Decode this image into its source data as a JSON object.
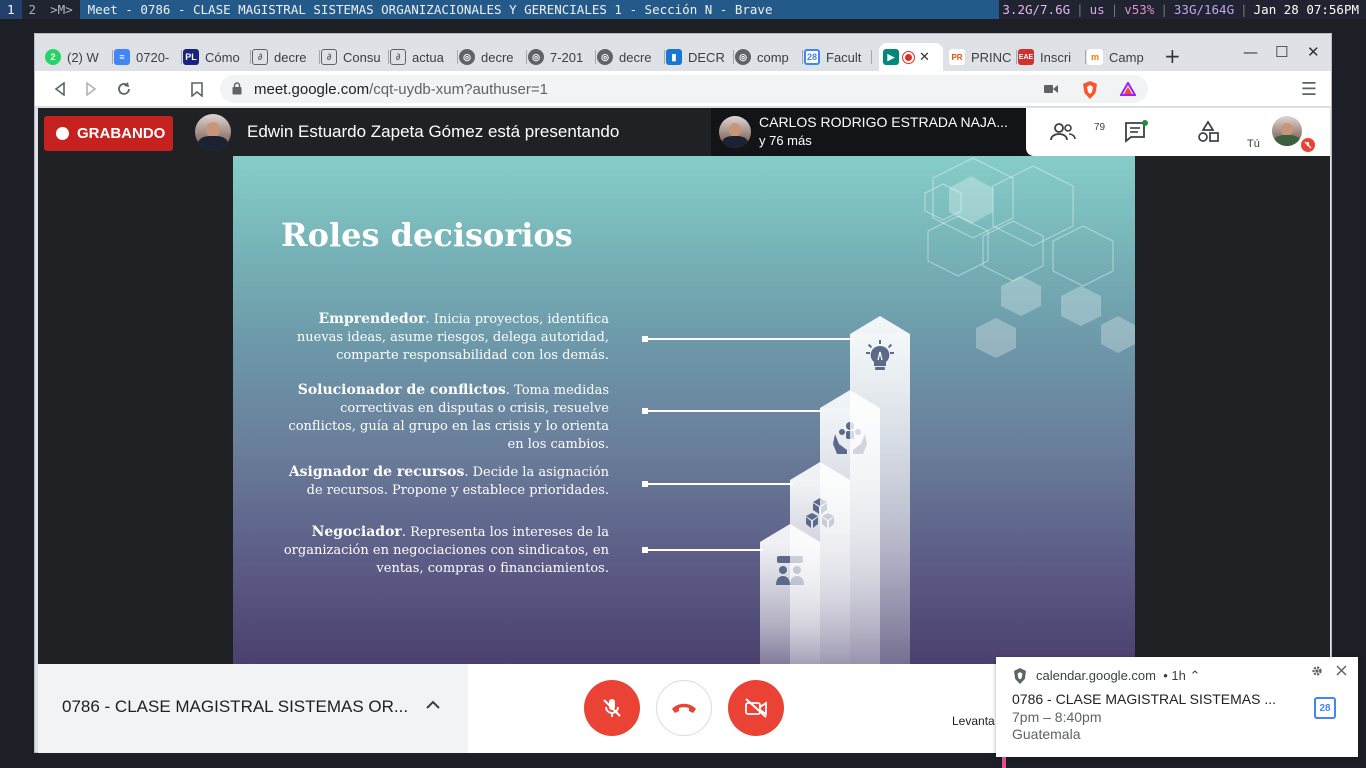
{
  "wm": {
    "workspaces": [
      "1",
      "2"
    ],
    "mode": ">M>",
    "title": "Meet - 0786 - CLASE MAGISTRAL SISTEMAS ORGANIZACIONALES Y GERENCIALES 1 - Sección N - Brave",
    "mem": "3.2G/7.6G",
    "lang": "us",
    "vol": "v53%",
    "disk": "33G/164G",
    "clock": "Jan 28 07:56PM"
  },
  "tabs": [
    {
      "label": "(2) W",
      "icon": "whatsapp-icon",
      "color": "#25d366"
    },
    {
      "label": "0720-",
      "icon": "google-docs-icon",
      "color": "#4285f4"
    },
    {
      "label": "Cómo",
      "icon": "pl-icon",
      "color": "#1a237e"
    },
    {
      "label": "decre",
      "icon": "link-icon",
      "color": "#5f6368"
    },
    {
      "label": "Consu",
      "icon": "link-icon",
      "color": "#5f6368"
    },
    {
      "label": "actua",
      "icon": "link-icon",
      "color": "#5f6368"
    },
    {
      "label": "decre",
      "icon": "globe-icon",
      "color": "#5f6368"
    },
    {
      "label": "7-201",
      "icon": "globe-icon",
      "color": "#5f6368"
    },
    {
      "label": "decre",
      "icon": "globe-icon",
      "color": "#5f6368"
    },
    {
      "label": "DECR",
      "icon": "doc-icon",
      "color": "#1976d2"
    },
    {
      "label": "comp",
      "icon": "globe-icon",
      "color": "#5f6368"
    },
    {
      "label": "Facult",
      "icon": "calendar-icon",
      "color": "#4285f4"
    },
    {
      "label": "",
      "icon": "meet-icon",
      "color": "#00897b"
    },
    {
      "label": "PRINC",
      "icon": "prin-icon",
      "color": "#e65100"
    },
    {
      "label": "Inscri",
      "icon": "eae-icon",
      "color": "#d32f2f"
    },
    {
      "label": "Camp",
      "icon": "moodle-icon",
      "color": "#f57c00"
    }
  ],
  "url": {
    "host": "meet.google.com",
    "path": "/cqt-uydb-xum?authuser=1"
  },
  "meet": {
    "recording_label": "GRABANDO",
    "presenter_text": "Edwin Estuardo Zapeta Gómez está presentando",
    "speaker_name": "CARLOS RODRIGO ESTRADA NAJA...",
    "speaker_more": "y 76 más",
    "people_count": "79",
    "self_label": "Tú",
    "meeting_name": "0786 - CLASE MAGISTRAL SISTEMAS OR...",
    "raise_hand_label": "Levanta"
  },
  "slide": {
    "title": "Roles decisorios",
    "roles": [
      {
        "name": "Emprendedor",
        "desc": ". Inicia proyectos, identifica nuevas ideas, asume riesgos, delega autoridad, comparte responsabilidad con los demás."
      },
      {
        "name": "Solucionador de conflictos",
        "desc": ". Toma medidas correctivas en disputas o crisis, resuelve conflictos, guía al grupo en las crisis y lo orienta en los cambios."
      },
      {
        "name": "Asignador de recursos",
        "desc": ". Decide la asignación de recursos. Propone y establece prioridades."
      },
      {
        "name": "Negociador",
        "desc": ". Representa los intereses de la organización en negociaciones con sindicatos, en ventas, compras o financiamientos."
      }
    ]
  },
  "notification": {
    "origin": "calendar.google.com",
    "age": "• 1h ⌃",
    "title": "0786 - CLASE MAGISTRAL SISTEMAS ...",
    "time": "7pm – 8:40pm",
    "place": "Guatemala",
    "calendar_day": "28"
  },
  "colors": {
    "record": "#c5221f",
    "end_call": "#ea4335",
    "brand_meet": "#00897b"
  }
}
